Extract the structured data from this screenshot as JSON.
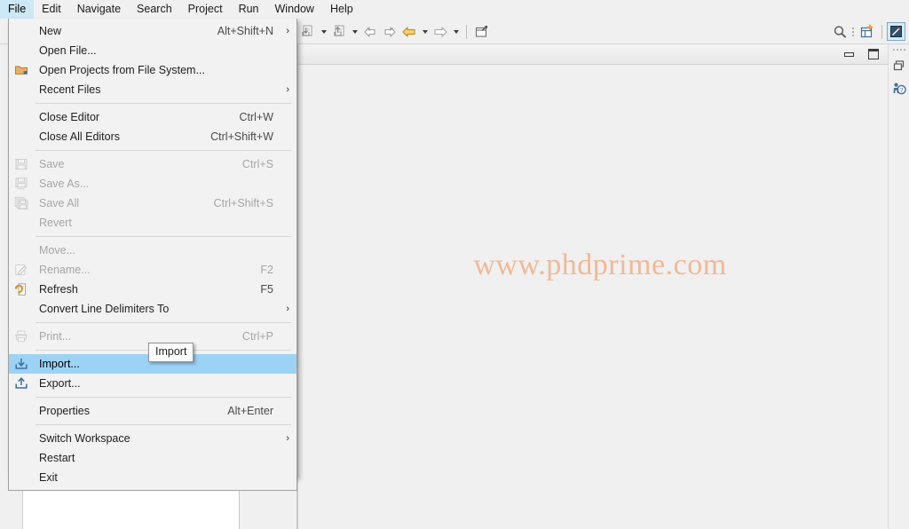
{
  "menubar": {
    "items": [
      {
        "label": "File",
        "active": true
      },
      {
        "label": "Edit",
        "active": false
      },
      {
        "label": "Navigate",
        "active": false
      },
      {
        "label": "Search",
        "active": false
      },
      {
        "label": "Project",
        "active": false
      },
      {
        "label": "Run",
        "active": false
      },
      {
        "label": "Window",
        "active": false
      },
      {
        "label": "Help",
        "active": false
      }
    ]
  },
  "toolbar": {
    "left_buttons": [
      {
        "icon": "import-toolbar-icon",
        "has_dropdown": true
      },
      {
        "icon": "export-toolbar-icon",
        "has_dropdown": true
      },
      {
        "icon": "back-history-icon",
        "has_dropdown": false
      },
      {
        "icon": "forward-history-icon",
        "has_dropdown": false
      },
      {
        "icon": "navigate-back-icon",
        "has_dropdown": true
      },
      {
        "icon": "navigate-forward-icon",
        "has_dropdown": true
      },
      {
        "icon": "new-window-icon",
        "has_dropdown": false
      }
    ],
    "right_buttons": [
      {
        "icon": "search-icon"
      },
      {
        "icon": "open-perspective-icon"
      },
      {
        "icon": "java-perspective-icon"
      }
    ]
  },
  "editor": {
    "watermark": "www.phdprime.com",
    "minimize_icon": "minimize-icon",
    "maximize_icon": "maximize-icon"
  },
  "perspective_bar": {
    "items": [
      {
        "icon": "restore-view-icon"
      },
      {
        "icon": "cheat-sheet-icon"
      }
    ]
  },
  "file_menu": {
    "items": [
      {
        "type": "item",
        "label": "New",
        "accel": "Alt+Shift+N",
        "submenu": true,
        "icon": null,
        "disabled": false,
        "selected": false,
        "name": "menu-item-new"
      },
      {
        "type": "item",
        "label": "Open File...",
        "accel": "",
        "submenu": false,
        "icon": null,
        "disabled": false,
        "selected": false,
        "name": "menu-item-open-file"
      },
      {
        "type": "item",
        "label": "Open Projects from File System...",
        "accel": "",
        "submenu": false,
        "icon": "folder-icon",
        "disabled": false,
        "selected": false,
        "name": "menu-item-open-projects-from-file-system"
      },
      {
        "type": "item",
        "label": "Recent Files",
        "accel": "",
        "submenu": true,
        "icon": null,
        "disabled": false,
        "selected": false,
        "name": "menu-item-recent-files"
      },
      {
        "type": "separator"
      },
      {
        "type": "item",
        "label": "Close Editor",
        "accel": "Ctrl+W",
        "submenu": false,
        "icon": null,
        "disabled": false,
        "selected": false,
        "name": "menu-item-close-editor"
      },
      {
        "type": "item",
        "label": "Close All Editors",
        "accel": "Ctrl+Shift+W",
        "submenu": false,
        "icon": null,
        "disabled": false,
        "selected": false,
        "name": "menu-item-close-all-editors"
      },
      {
        "type": "separator"
      },
      {
        "type": "item",
        "label": "Save",
        "accel": "Ctrl+S",
        "submenu": false,
        "icon": "save-icon",
        "disabled": true,
        "selected": false,
        "name": "menu-item-save"
      },
      {
        "type": "item",
        "label": "Save As...",
        "accel": "",
        "submenu": false,
        "icon": "save-as-icon",
        "disabled": true,
        "selected": false,
        "name": "menu-item-save-as"
      },
      {
        "type": "item",
        "label": "Save All",
        "accel": "Ctrl+Shift+S",
        "submenu": false,
        "icon": "save-all-icon",
        "disabled": true,
        "selected": false,
        "name": "menu-item-save-all"
      },
      {
        "type": "item",
        "label": "Revert",
        "accel": "",
        "submenu": false,
        "icon": null,
        "disabled": true,
        "selected": false,
        "name": "menu-item-revert"
      },
      {
        "type": "separator"
      },
      {
        "type": "item",
        "label": "Move...",
        "accel": "",
        "submenu": false,
        "icon": null,
        "disabled": true,
        "selected": false,
        "name": "menu-item-move"
      },
      {
        "type": "item",
        "label": "Rename...",
        "accel": "F2",
        "submenu": false,
        "icon": "rename-icon",
        "disabled": true,
        "selected": false,
        "name": "menu-item-rename"
      },
      {
        "type": "item",
        "label": "Refresh",
        "accel": "F5",
        "submenu": false,
        "icon": "refresh-icon",
        "disabled": false,
        "selected": false,
        "name": "menu-item-refresh"
      },
      {
        "type": "item",
        "label": "Convert Line Delimiters To",
        "accel": "",
        "submenu": true,
        "icon": null,
        "disabled": false,
        "selected": false,
        "name": "menu-item-convert-line-delimiters-to"
      },
      {
        "type": "separator"
      },
      {
        "type": "item",
        "label": "Print...",
        "accel": "Ctrl+P",
        "submenu": false,
        "icon": "print-icon",
        "disabled": true,
        "selected": false,
        "name": "menu-item-print"
      },
      {
        "type": "separator"
      },
      {
        "type": "item",
        "label": "Import...",
        "accel": "",
        "submenu": false,
        "icon": "import-icon",
        "disabled": false,
        "selected": true,
        "name": "menu-item-import"
      },
      {
        "type": "item",
        "label": "Export...",
        "accel": "",
        "submenu": false,
        "icon": "export-icon",
        "disabled": false,
        "selected": false,
        "name": "menu-item-export"
      },
      {
        "type": "separator"
      },
      {
        "type": "item",
        "label": "Properties",
        "accel": "Alt+Enter",
        "submenu": false,
        "icon": null,
        "disabled": false,
        "selected": false,
        "name": "menu-item-properties"
      },
      {
        "type": "separator"
      },
      {
        "type": "item",
        "label": "Switch Workspace",
        "accel": "",
        "submenu": true,
        "icon": null,
        "disabled": false,
        "selected": false,
        "name": "menu-item-switch-workspace"
      },
      {
        "type": "item",
        "label": "Restart",
        "accel": "",
        "submenu": false,
        "icon": null,
        "disabled": false,
        "selected": false,
        "name": "menu-item-restart"
      },
      {
        "type": "item",
        "label": "Exit",
        "accel": "",
        "submenu": false,
        "icon": null,
        "disabled": false,
        "selected": false,
        "name": "menu-item-exit"
      }
    ],
    "submenu_glyph": "›"
  },
  "tooltip": {
    "text": "Import"
  },
  "colors": {
    "menubar_active_bg": "#cde8f6",
    "menu_selection_bg": "#9cd3f5",
    "watermark": "#f3b894",
    "window_bg": "#f0f0f0",
    "panel_white": "#ffffff",
    "accent_orange": "#e8a33d"
  }
}
